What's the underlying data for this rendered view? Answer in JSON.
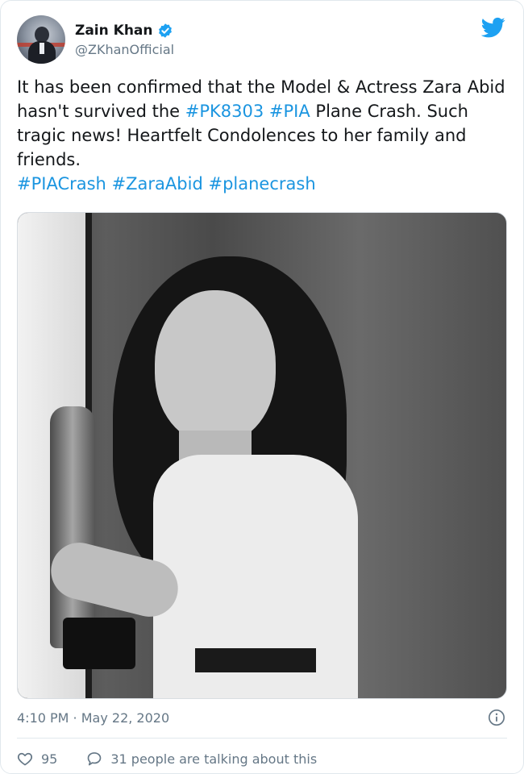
{
  "author": {
    "display_name": "Zain Khan",
    "handle": "@ZKhanOfficial",
    "verified_icon": "verified-badge-icon",
    "verified_color": "#1da1f2"
  },
  "brand": {
    "icon": "twitter-bird-icon",
    "color": "#1da1f2"
  },
  "tweet": {
    "text_part1": "It has been confirmed that the Model & Actress Zara Abid hasn't survived the ",
    "tag1": "#PK8303",
    "tag2": "#PIA",
    "text_part2": " Plane Crash. Such tragic news! Heartfelt Condolences to her family and friends.",
    "tag3": "#PIACrash",
    "tag4": "#ZaraAbid",
    "tag5": "#planecrash",
    "hashtag_color": "#1b95e0"
  },
  "timestamp": "4:10 PM · May 22, 2020",
  "footer": {
    "like_icon": "heart-icon",
    "like_count": "95",
    "reply_icon": "speech-bubble-icon",
    "reply_text": "31 people are talking about this",
    "info_icon": "info-icon"
  }
}
